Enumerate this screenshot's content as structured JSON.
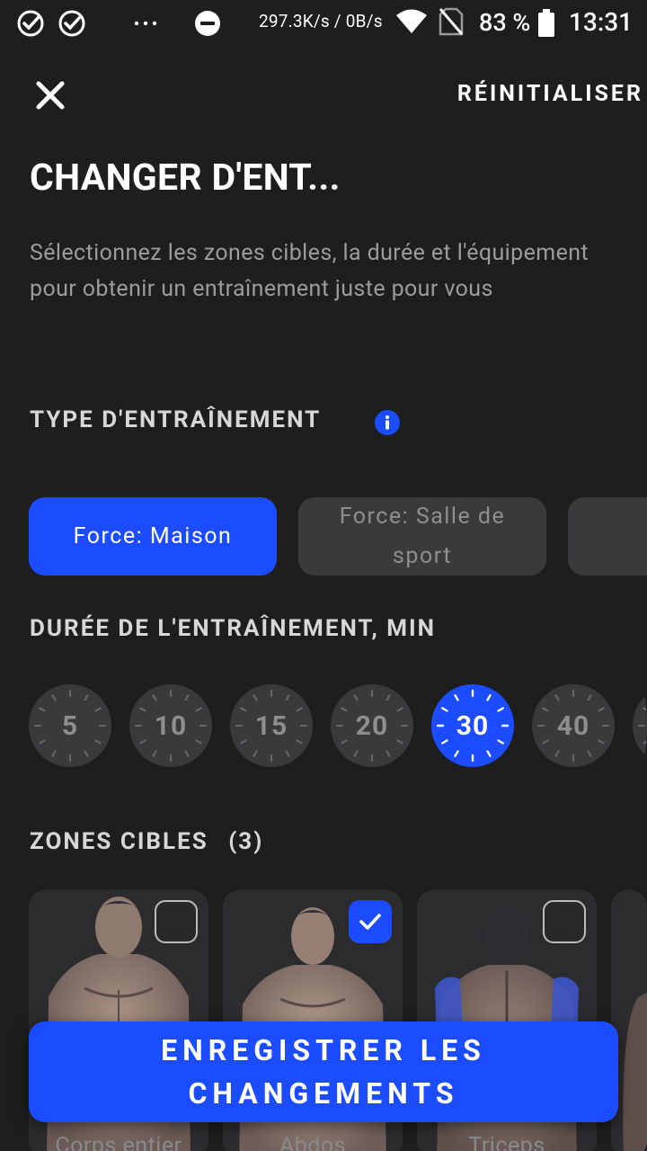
{
  "statusbar": {
    "net_speed": "297.3K/s / 0B/s",
    "battery": "83 %",
    "time": "13:31",
    "icons": [
      "check-circle-icon",
      "check-circle-icon",
      "more-dots-icon",
      "do-not-disturb-icon",
      "wifi-icon",
      "no-sim-icon",
      "battery-icon"
    ]
  },
  "header": {
    "reset_label": "RÉINITIALISER",
    "title": "CHANGER D'ENT...",
    "subtitle": "Sélectionnez les zones cibles, la durée et l'équipement pour obtenir un entraînement juste pour vous"
  },
  "training_type": {
    "title": "TYPE D'ENTRAÎNEMENT",
    "options": [
      {
        "label": "Force: Maison",
        "selected": true
      },
      {
        "label": "Force: Salle de sport",
        "selected": false
      },
      {
        "label": "",
        "selected": false
      }
    ]
  },
  "duration": {
    "title": "DURÉE DE L'ENTRAÎNEMENT, MIN",
    "options": [
      "5",
      "10",
      "15",
      "20",
      "30",
      "40",
      ""
    ],
    "selected": "30"
  },
  "zones": {
    "title": "ZONES CIBLES",
    "count": "(3)",
    "cards": [
      {
        "label": "Corps entier",
        "checked": false
      },
      {
        "label": "Abdos",
        "checked": true
      },
      {
        "label": "Triceps",
        "checked": false
      },
      {
        "label": "",
        "checked": false
      }
    ]
  },
  "save_button": "ENREGISTRER LES CHANGEMENTS",
  "colors": {
    "background": "#1e1e1f",
    "accent": "#1b4cff",
    "chip_inactive": "#3a3a3d",
    "text_muted": "#9c9c9c"
  }
}
